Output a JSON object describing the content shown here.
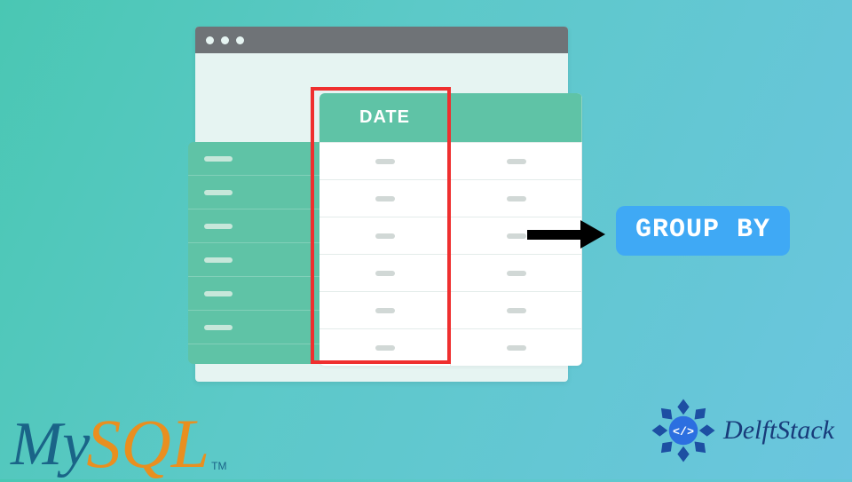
{
  "diagram": {
    "column_header": "DATE",
    "action_label": "GROUP BY"
  },
  "logos": {
    "mysql_part1": "My",
    "mysql_part2": "SQL",
    "mysql_tm": "TM",
    "delftstack_text": "DelftStack",
    "delftstack_glyph": "</>"
  },
  "colors": {
    "highlight": "#ef2f2f",
    "badge": "#3fa9f5",
    "table_header": "#5fc3a6"
  }
}
